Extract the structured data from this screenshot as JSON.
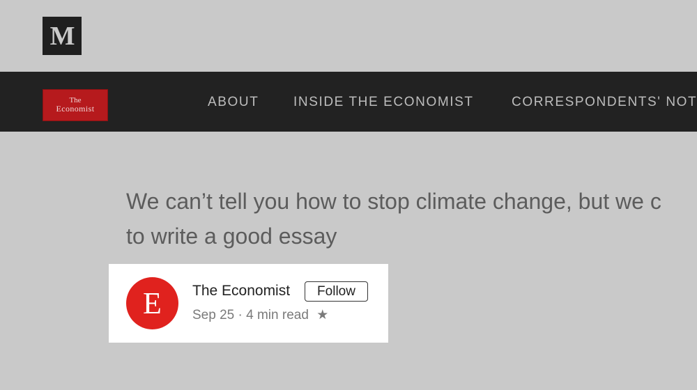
{
  "medium": {
    "logo_text": "M"
  },
  "publication": {
    "logo_line1": "The",
    "logo_line2": "Economist",
    "nav": [
      {
        "label": "ABOUT"
      },
      {
        "label": "INSIDE THE ECONOMIST"
      },
      {
        "label": "CORRESPONDENTS' NOT"
      }
    ]
  },
  "article": {
    "headline_line1": "We can’t tell you how to stop climate change, but we c",
    "headline_line2": "to write a good essay",
    "author": {
      "avatar_letter": "E",
      "name": "The Economist",
      "follow_label": "Follow",
      "date": "Sep 25",
      "separator": "·",
      "read_time": "4 min read",
      "star_icon": "★"
    }
  },
  "colors": {
    "background": "#c9c9c9",
    "nav_bar": "#222222",
    "economist_red": "#e0221e"
  }
}
